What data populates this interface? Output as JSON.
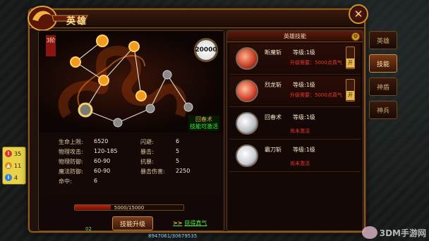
{
  "window": {
    "title": "英雄",
    "close_glyph": "✕"
  },
  "alerts": [
    {
      "value": "35",
      "color": "#d7352a",
      "icon": "exclamation-icon"
    },
    {
      "value": "11",
      "color": "#e08a1e",
      "icon": "warning-icon"
    },
    {
      "value": "4",
      "color": "#2f7de0",
      "icon": "info-icon"
    }
  ],
  "constellation": {
    "tier_label": "3阶",
    "points": "20000"
  },
  "selected_skill": {
    "name": "回春术",
    "status": "技能可激活"
  },
  "stats": {
    "hp_label": "生命上限:",
    "hp_value": "6520",
    "patk_label": "物理攻击:",
    "patk_value": "120-185",
    "pdef_label": "物理防御:",
    "pdef_value": "60-90",
    "mdef_label": "魔法防御:",
    "mdef_value": "60-90",
    "hit_label": "命中:",
    "hit_value": "6",
    "dodge_label": "闪避:",
    "dodge_value": "6",
    "crit_label": "暴击:",
    "crit_value": "5",
    "res_label": "抗暴:",
    "res_value": "5",
    "critdmg_label": "暴击伤害:",
    "critdmg_value": "2250"
  },
  "progress": {
    "text": "5000/15000",
    "fraction": 0.33
  },
  "buttons": {
    "upgrade": "技能升级",
    "gain": "获得真气",
    "gain_arrow": ">>"
  },
  "skills_panel": {
    "header": "英雄技能",
    "skills": [
      {
        "name": "断魔斩",
        "level": "等级:1级",
        "requirement": "升级需要：5000点真气",
        "toggle": "开",
        "icon_color": "#c43a22"
      },
      {
        "name": "烈龙斩",
        "level": "等级:1级",
        "requirement": "升级需要：5000点真气",
        "toggle": "开",
        "icon_color": "#d2412a"
      },
      {
        "name": "回春术",
        "level": "等级:1级",
        "requirement": "尚未激活",
        "toggle": "",
        "icon_color": "#b9bcc2"
      },
      {
        "name": "霸刀斩",
        "level": "等级:1级",
        "requirement": "尚未激活",
        "toggle": "",
        "icon_color": "#c8ccd2"
      }
    ]
  },
  "side_tabs": [
    {
      "label": "英雄",
      "active": false
    },
    {
      "label": "技能",
      "active": true
    },
    {
      "label": "神盾",
      "active": false
    },
    {
      "label": "神兵",
      "active": false
    }
  ],
  "footer": {
    "left_value": "02",
    "exp_text": "8947061/30679535"
  },
  "watermark": {
    "text": "3DM手游网"
  }
}
